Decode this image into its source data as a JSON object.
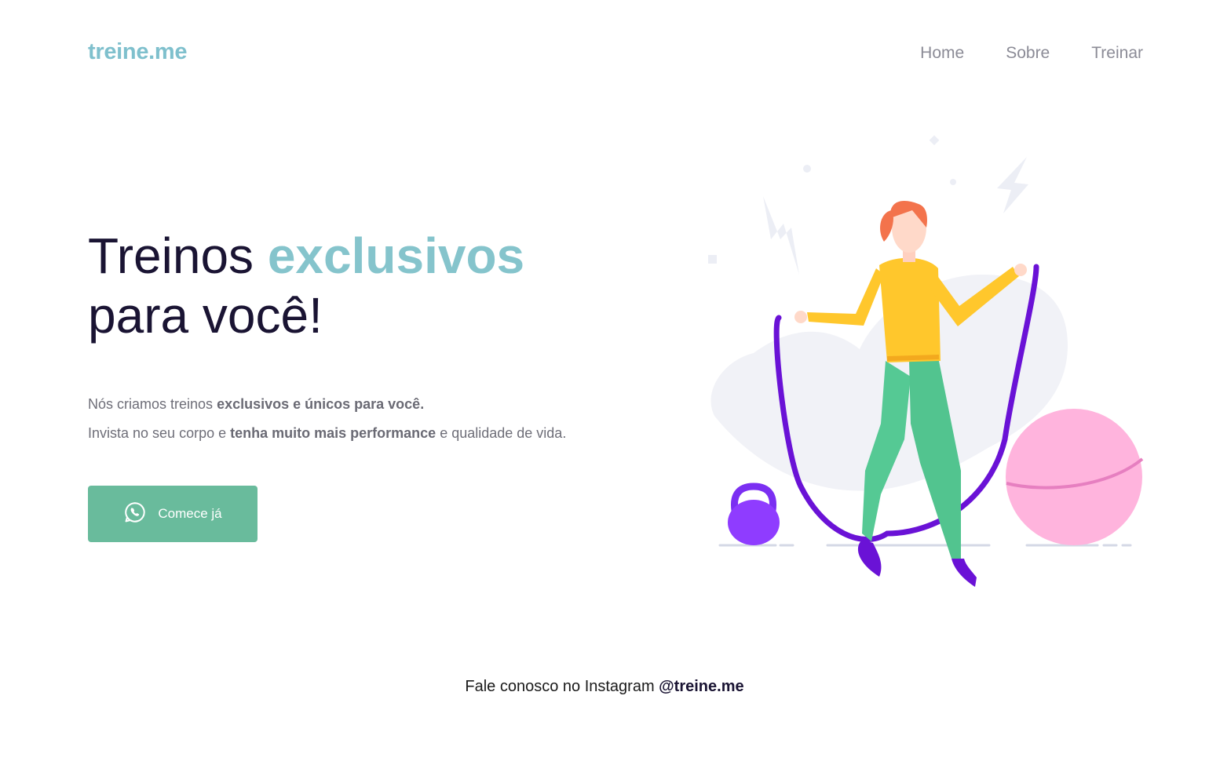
{
  "header": {
    "logo": "treine.me",
    "nav": [
      "Home",
      "Sobre",
      "Treinar"
    ]
  },
  "hero": {
    "title_part1": "Treinos ",
    "title_accent": "exclusivos",
    "title_part2": "para você!",
    "line1_prefix": "Nós criamos treinos ",
    "line1_bold": "exclusivos e únicos para você.",
    "line2_prefix": "Invista no seu corpo e ",
    "line2_bold": "tenha muito mais performance",
    "line2_suffix": " e qualidade de vida.",
    "cta_label": "Comece já",
    "cta_icon": "whatsapp-icon"
  },
  "illustration": {
    "icon": "woman-jumping-rope-illustration"
  },
  "footer": {
    "prefix": "Fale conosco no Instagram ",
    "handle": "@treine.me"
  },
  "colors": {
    "logo": "#7fc0cd",
    "accent": "#85c4cc",
    "heading": "#1a1433",
    "button": "#69bb9c",
    "nav": "#8b8b96"
  }
}
